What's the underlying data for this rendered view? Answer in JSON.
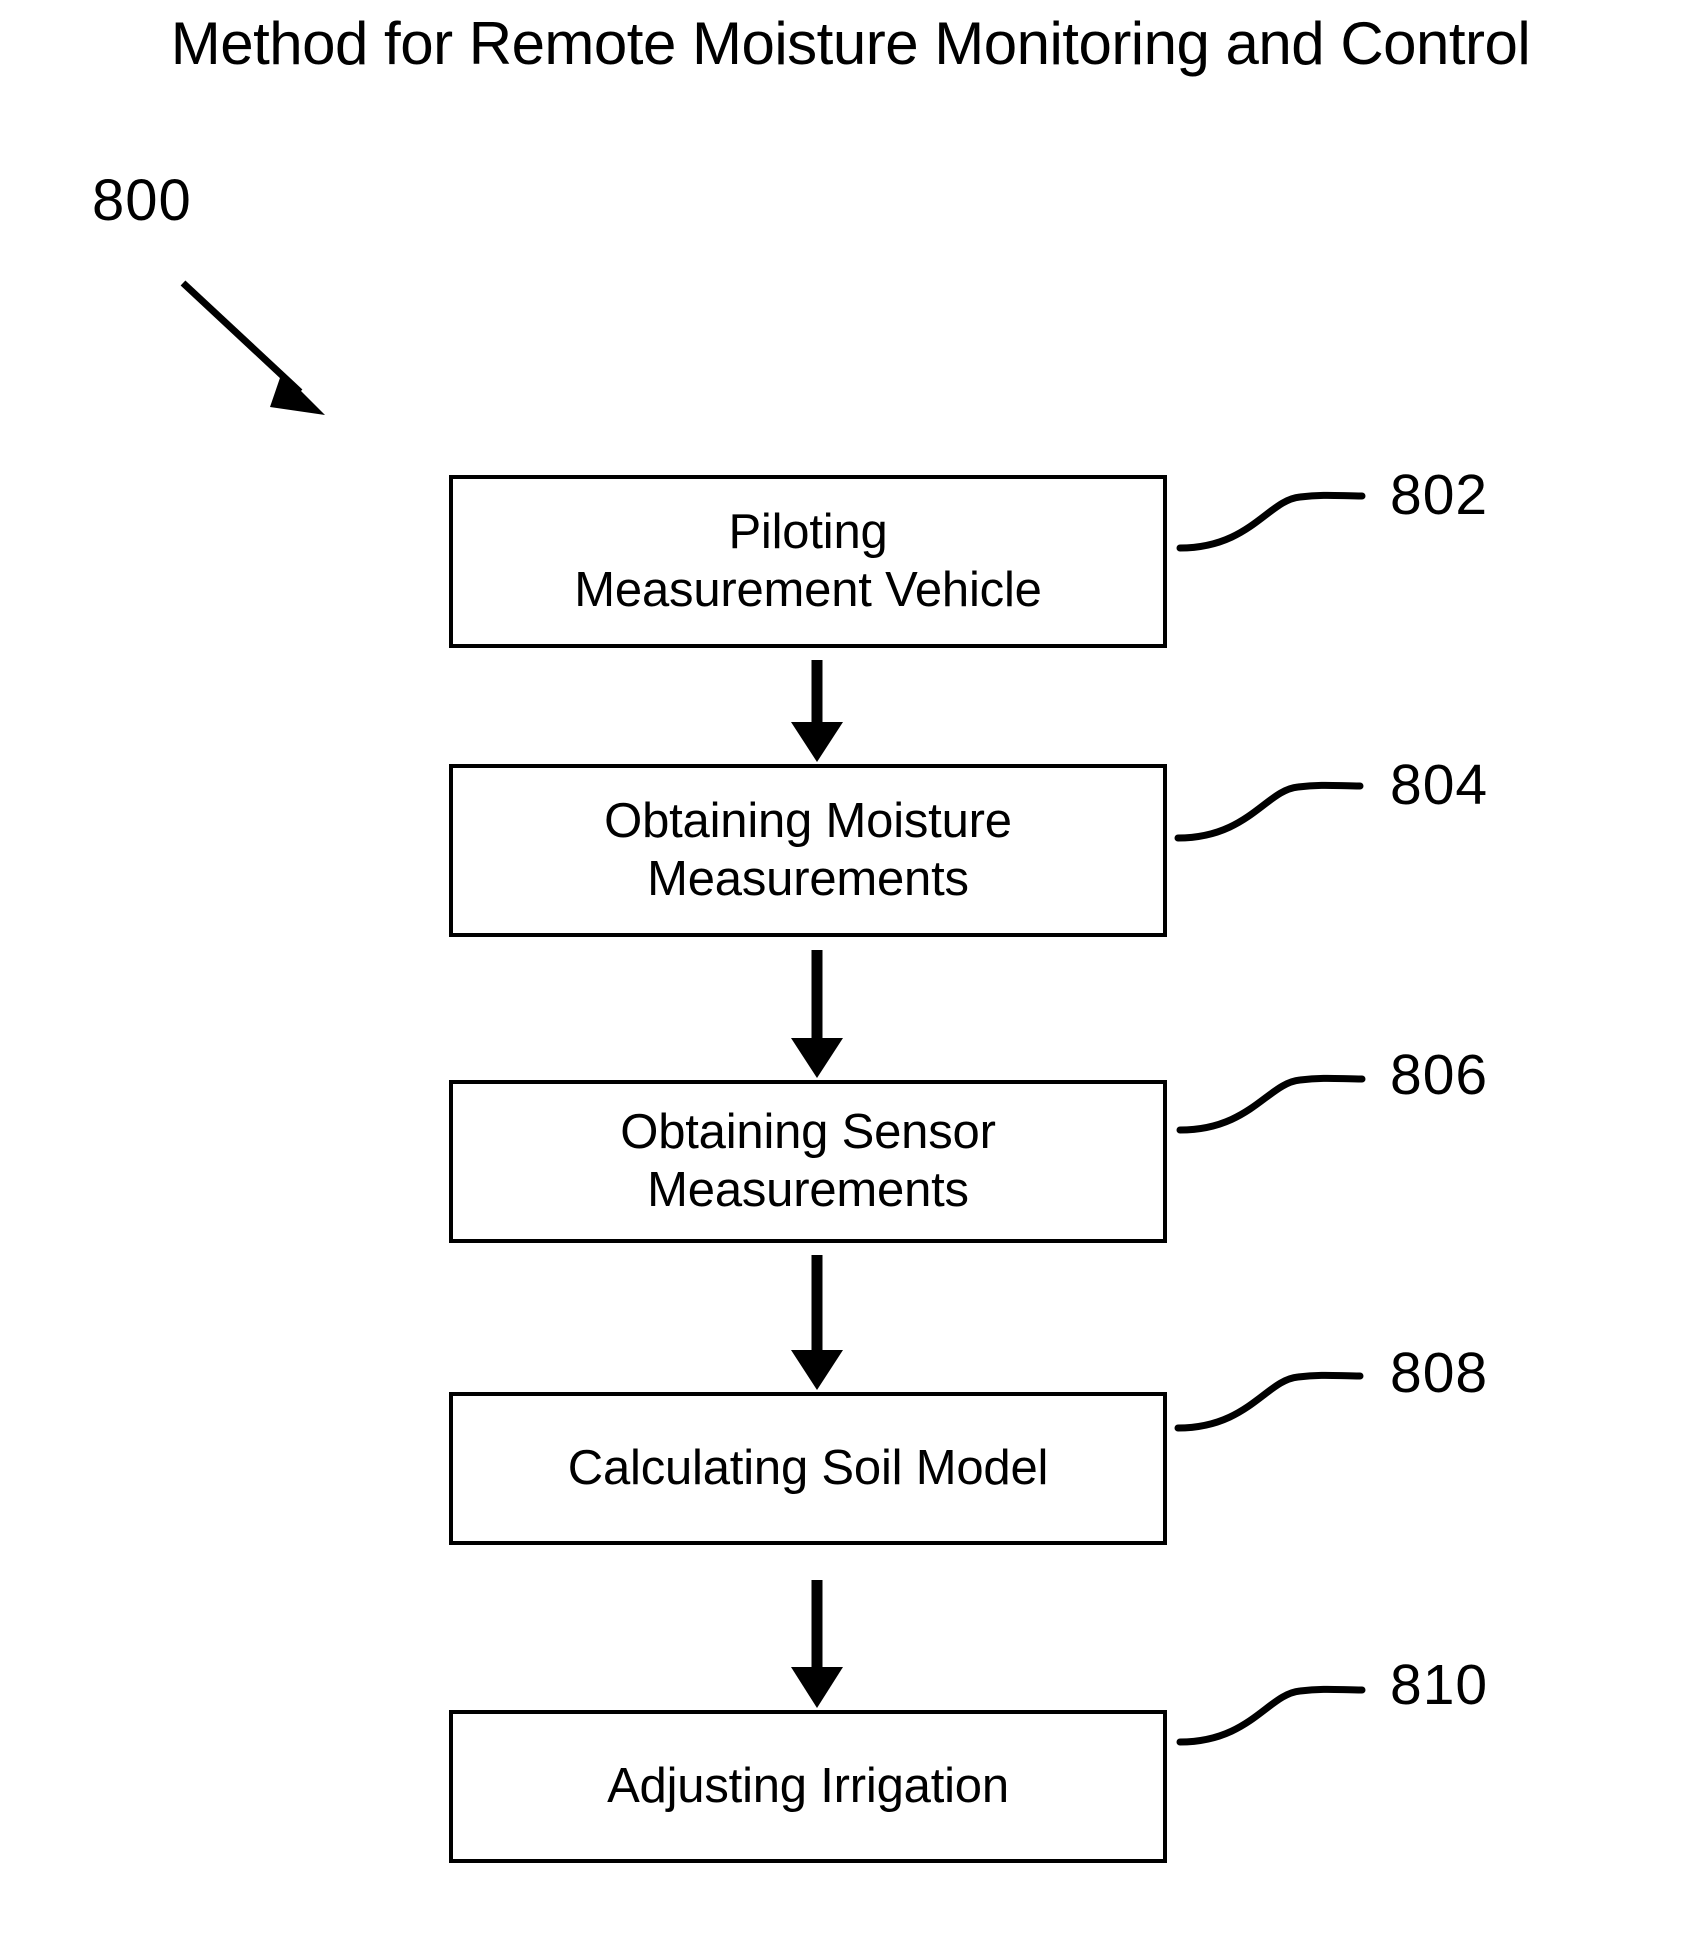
{
  "figure": {
    "title": "Method for Remote Moisture Monitoring and Control",
    "figure_number": "800",
    "background_color": "#ffffff",
    "line_color": "#000000"
  },
  "steps": [
    {
      "label": "Piloting\nMeasurement Vehicle",
      "line1": "Piloting",
      "line2": "Measurement Vehicle",
      "reference": "802"
    },
    {
      "label": "Obtaining Moisture\nMeasurements",
      "line1": "Obtaining Moisture",
      "line2": "Measurements",
      "reference": "804"
    },
    {
      "label": "Obtaining Sensor\nMeasurements",
      "line1": "Obtaining Sensor",
      "line2": "Measurements",
      "reference": "806"
    },
    {
      "label": "Calculating Soil Model",
      "line1": "Calculating Soil Model",
      "line2": "",
      "reference": "808"
    },
    {
      "label": "Adjusting Irrigation",
      "line1": "Adjusting Irrigation",
      "line2": "",
      "reference": "810"
    }
  ]
}
